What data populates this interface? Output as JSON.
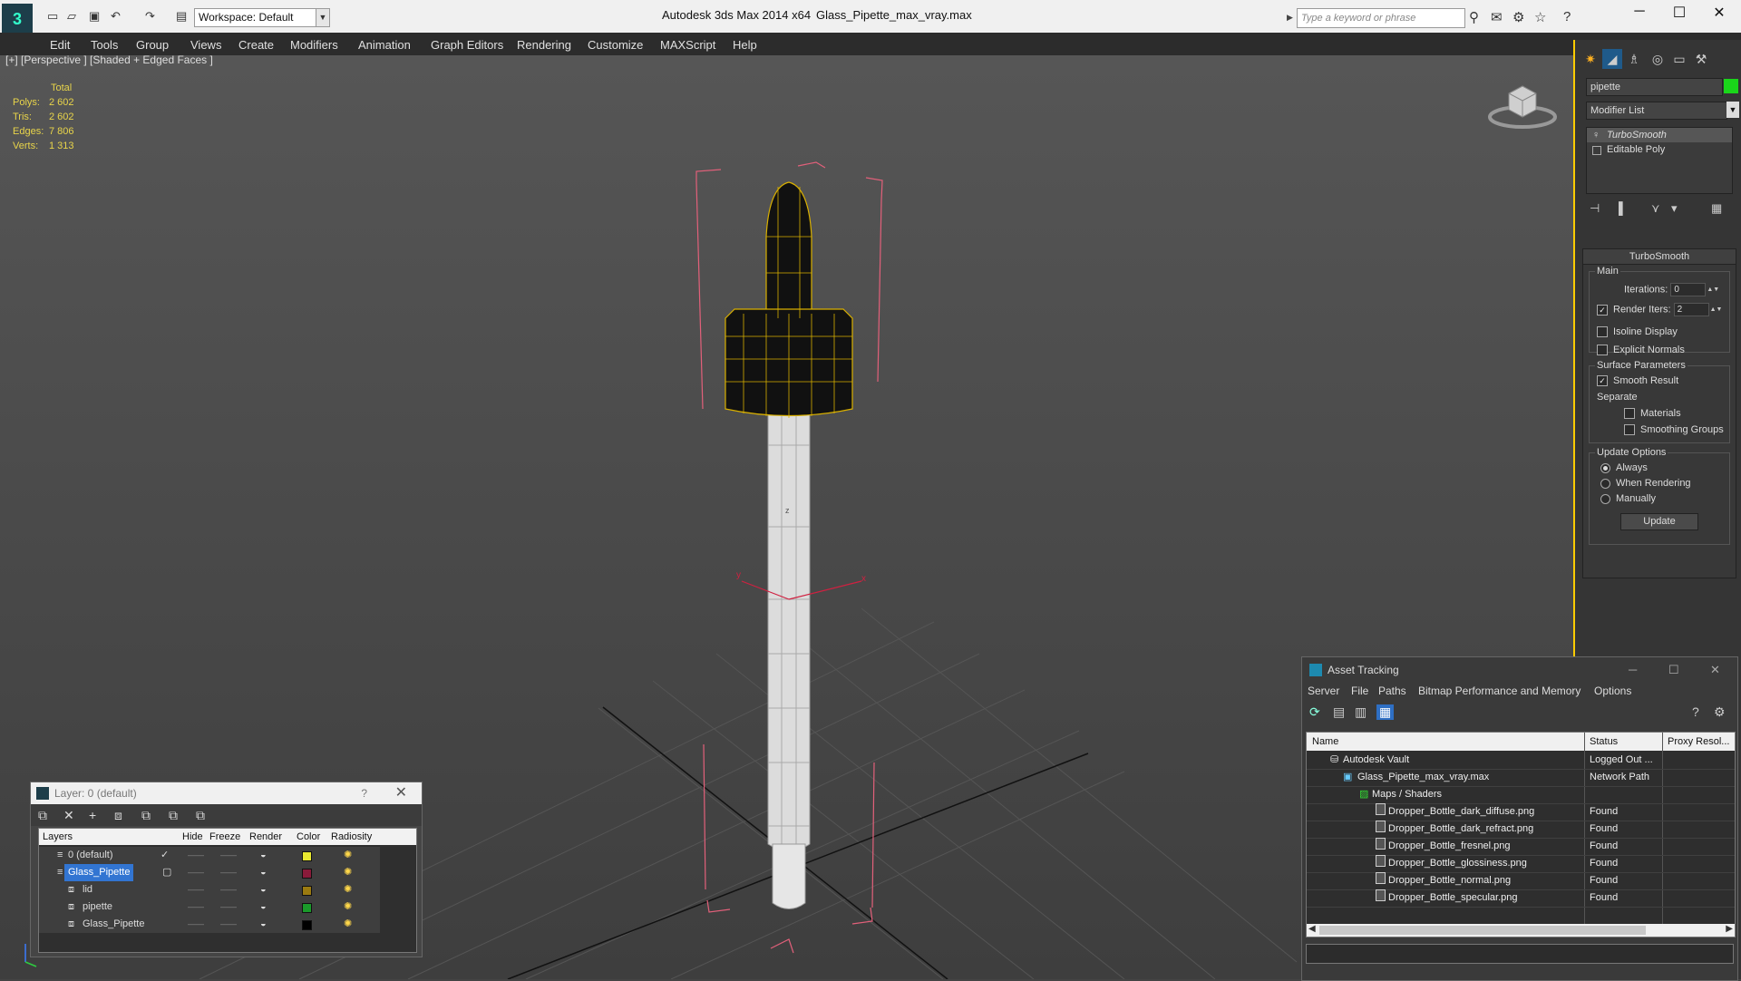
{
  "app": {
    "title": "Autodesk 3ds Max  2014 x64",
    "file": "Glass_Pipette_max_vray.max",
    "workspace": "Workspace: Default",
    "search_placeholder": "Type a keyword or phrase",
    "logo": "3"
  },
  "menu": [
    "Edit",
    "Tools",
    "Group",
    "Views",
    "Create",
    "Modifiers",
    "Animation",
    "Graph Editors",
    "Rendering",
    "Customize",
    "MAXScript",
    "Help"
  ],
  "viewport": {
    "label": "[+] [Perspective ] [Shaded + Edged Faces ]",
    "stats": {
      "header": "Total",
      "rows": [
        {
          "label": "Polys:",
          "value": "2 602"
        },
        {
          "label": "Tris:",
          "value": "2 602"
        },
        {
          "label": "Edges:",
          "value": "7 806"
        },
        {
          "label": "Verts:",
          "value": "1 313"
        }
      ]
    },
    "gizmo": {
      "x": "x",
      "y": "y",
      "z": "z"
    }
  },
  "command_panel": {
    "object_name": "pipette",
    "object_color": "#1ad61a",
    "modifier_list": "Modifier List",
    "stack": [
      "TurboSmooth",
      "Editable Poly"
    ],
    "rollout": "TurboSmooth",
    "main_group": "Main",
    "iterations_label": "Iterations:",
    "iterations_value": "0",
    "render_iters_label": "Render Iters:",
    "render_iters_value": "2",
    "isoline": "Isoline Display",
    "explicit_normals": "Explicit Normals",
    "surface_group": "Surface Parameters",
    "smooth_result": "Smooth Result",
    "separate": "Separate",
    "materials": "Materials",
    "smoothing_groups": "Smoothing Groups",
    "update_group": "Update Options",
    "always": "Always",
    "when_rendering": "When Rendering",
    "manually": "Manually",
    "update_button": "Update"
  },
  "layer_window": {
    "title": "Layer: 0 (default)",
    "help": "?",
    "columns": [
      "Layers",
      "Hide",
      "Freeze",
      "Render",
      "Color",
      "Radiosity"
    ],
    "rows": [
      {
        "name": "0 (default)",
        "color": "#e8e830"
      },
      {
        "name": "Glass_Pipette",
        "color": "#8a1a3a"
      },
      {
        "name": "lid",
        "color": "#9a7a10"
      },
      {
        "name": "pipette",
        "color": "#1a9a2a"
      },
      {
        "name": "Glass_Pipette",
        "color": "#000000"
      }
    ]
  },
  "asset_window": {
    "title": "Asset Tracking",
    "menu": [
      "Server",
      "File",
      "Paths",
      "Bitmap Performance and Memory",
      "Options"
    ],
    "columns": [
      "Name",
      "Status",
      "Proxy Resol..."
    ],
    "rows": [
      {
        "name": "Autodesk Vault",
        "status": "Logged Out ..."
      },
      {
        "name": "Glass_Pipette_max_vray.max",
        "status": "Network Path"
      },
      {
        "name": "Maps / Shaders",
        "status": ""
      },
      {
        "name": "Dropper_Bottle_dark_diffuse.png",
        "status": "Found"
      },
      {
        "name": "Dropper_Bottle_dark_refract.png",
        "status": "Found"
      },
      {
        "name": "Dropper_Bottle_fresnel.png",
        "status": "Found"
      },
      {
        "name": "Dropper_Bottle_glossiness.png",
        "status": "Found"
      },
      {
        "name": "Dropper_Bottle_normal.png",
        "status": "Found"
      },
      {
        "name": "Dropper_Bottle_specular.png",
        "status": "Found"
      }
    ]
  }
}
